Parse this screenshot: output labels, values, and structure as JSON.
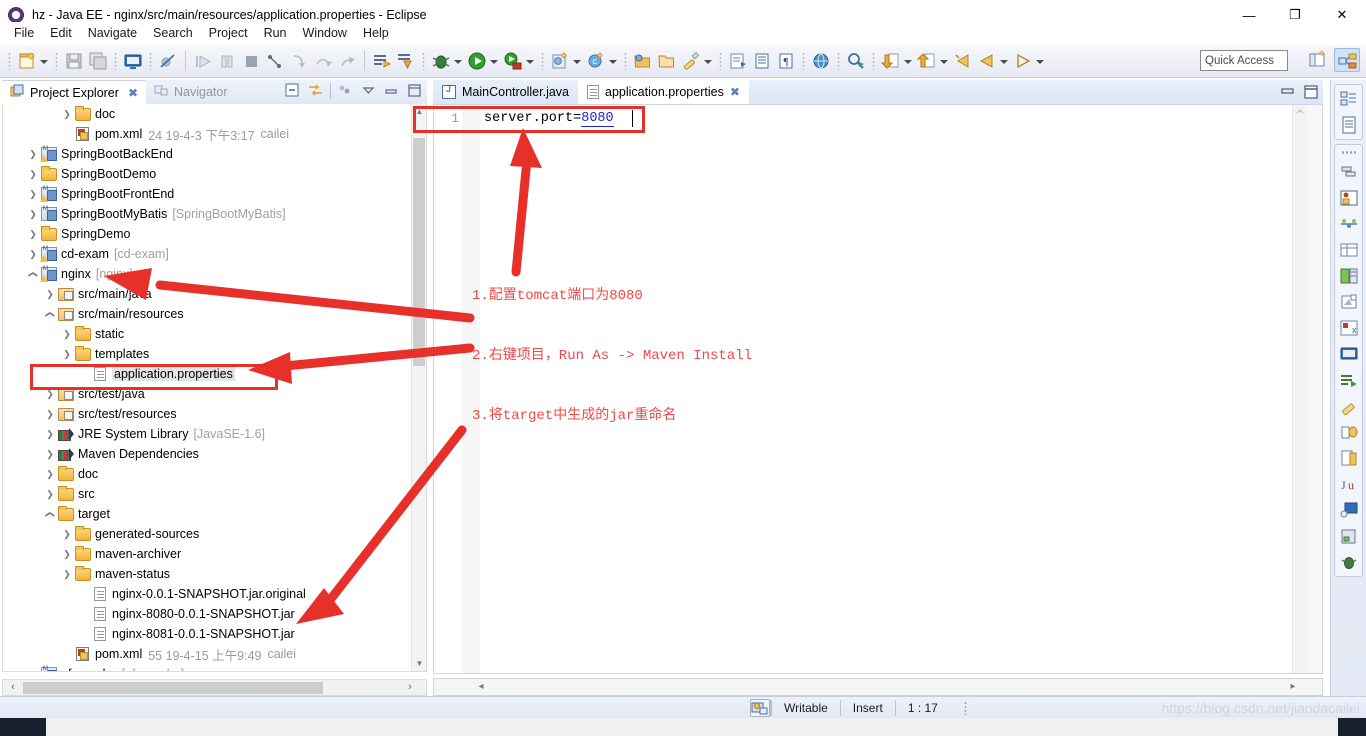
{
  "window": {
    "title": "hz - Java EE - nginx/src/main/resources/application.properties - Eclipse",
    "app_icon": "eclipse-icon",
    "minimize": "—",
    "maximize": "❐",
    "close": "✕"
  },
  "menu": {
    "items": [
      "File",
      "Edit",
      "Navigate",
      "Search",
      "Project",
      "Run",
      "Window",
      "Help"
    ]
  },
  "toolbar": {
    "quick_access_placeholder": "Quick Access",
    "icons": [
      "new-wizard-icon",
      "save-icon",
      "save-all-icon",
      "console-icon",
      "skip-breakpoints-icon",
      "resume-icon",
      "suspend-icon",
      "terminate-icon",
      "step-into-selection-icon",
      "step-into-icon",
      "step-over-icon",
      "step-return-icon",
      "run-last-tool-icon",
      "external-tools-icon",
      "debug-icon",
      "run-icon",
      "run-server-icon",
      "new-java-project-icon",
      "new-class-icon",
      "open-type-icon",
      "open-task-icon",
      "toggle-mark-occurrences-icon",
      "new-xml-icon",
      "show-whitespace-icon",
      "open-web-browser-icon",
      "search-icon",
      "next-annotation-icon",
      "previous-annotation-icon",
      "last-edit-location-icon",
      "back-icon",
      "forward-icon"
    ],
    "perspective_buttons": [
      "open-perspective-icon",
      "java-ee-perspective-icon"
    ]
  },
  "left_panel": {
    "tabs": [
      {
        "label": "Project Explorer",
        "icon": "project-explorer-icon",
        "active": true,
        "closable": true
      },
      {
        "label": "Navigator",
        "icon": "navigator-icon",
        "active": false,
        "closable": false
      }
    ],
    "toolbar_icons": [
      "collapse-all-icon",
      "link-with-editor-icon",
      "view-menu-icon",
      "minimize-icon",
      "maximize-icon"
    ],
    "tree": [
      {
        "indent": 3,
        "twist": "collapsed",
        "icon": "folder-icon",
        "label": "doc"
      },
      {
        "indent": 3,
        "twist": "none",
        "icon": "xml-file-icon",
        "label": "pom.xml",
        "meta": "24   19-4-3 下午3:17",
        "author": "cailei"
      },
      {
        "indent": 1,
        "twist": "collapsed",
        "icon": "maven-project-warn-icon",
        "label": "SpringBootBackEnd"
      },
      {
        "indent": 1,
        "twist": "collapsed",
        "icon": "folder-plain-icon",
        "label": "SpringBootDemo"
      },
      {
        "indent": 1,
        "twist": "collapsed",
        "icon": "maven-project-warn-icon",
        "label": "SpringBootFrontEnd"
      },
      {
        "indent": 1,
        "twist": "collapsed",
        "icon": "maven-project-icon",
        "label": "SpringBootMyBatis",
        "bracket": "[SpringBootMyBatis]"
      },
      {
        "indent": 1,
        "twist": "collapsed",
        "icon": "folder-plain-icon",
        "label": "SpringDemo"
      },
      {
        "indent": 1,
        "twist": "collapsed",
        "icon": "maven-project-warn-icon",
        "label": "cd-exam",
        "bracket": "[cd-exam]"
      },
      {
        "indent": 1,
        "twist": "expanded",
        "icon": "maven-project-warn-icon",
        "label": "nginx",
        "bracket": "[nginx]"
      },
      {
        "indent": 2,
        "twist": "collapsed",
        "icon": "source-folder-icon",
        "label": "src/main/java"
      },
      {
        "indent": 2,
        "twist": "expanded",
        "icon": "source-folder-icon",
        "label": "src/main/resources"
      },
      {
        "indent": 3,
        "twist": "collapsed",
        "icon": "folder-icon",
        "label": "static"
      },
      {
        "indent": 3,
        "twist": "collapsed",
        "icon": "folder-icon",
        "label": "templates"
      },
      {
        "indent": 4,
        "twist": "none",
        "icon": "properties-file-icon",
        "label": "application.properties",
        "selected": true
      },
      {
        "indent": 2,
        "twist": "collapsed",
        "icon": "source-folder-icon",
        "label": "src/test/java"
      },
      {
        "indent": 2,
        "twist": "collapsed",
        "icon": "source-folder-icon",
        "label": "src/test/resources"
      },
      {
        "indent": 2,
        "twist": "collapsed",
        "icon": "library-icon",
        "label": "JRE System Library",
        "bracket": "[JavaSE-1.6]"
      },
      {
        "indent": 2,
        "twist": "collapsed",
        "icon": "library-icon",
        "label": "Maven Dependencies"
      },
      {
        "indent": 2,
        "twist": "collapsed",
        "icon": "folder-icon",
        "label": "doc"
      },
      {
        "indent": 2,
        "twist": "collapsed",
        "icon": "folder-icon",
        "label": "src"
      },
      {
        "indent": 2,
        "twist": "expanded",
        "icon": "folder-open-icon",
        "label": "target"
      },
      {
        "indent": 3,
        "twist": "collapsed",
        "icon": "folder-open-icon",
        "label": "generated-sources"
      },
      {
        "indent": 3,
        "twist": "collapsed",
        "icon": "folder-open-icon",
        "label": "maven-archiver"
      },
      {
        "indent": 3,
        "twist": "collapsed",
        "icon": "folder-open-icon",
        "label": "maven-status"
      },
      {
        "indent": 4,
        "twist": "none",
        "icon": "file-icon",
        "label": "nginx-0.0.1-SNAPSHOT.jar.original"
      },
      {
        "indent": 4,
        "twist": "none",
        "icon": "file-icon",
        "label": "nginx-8080-0.0.1-SNAPSHOT.jar"
      },
      {
        "indent": 4,
        "twist": "none",
        "icon": "file-icon",
        "label": "nginx-8081-0.0.1-SNAPSHOT.jar"
      },
      {
        "indent": 3,
        "twist": "none",
        "icon": "xml-file-icon",
        "label": "pom.xml",
        "meta": "55   19-4-15 上午9:49",
        "author": "cailei"
      },
      {
        "indent": 1,
        "twist": "expanded",
        "icon": "maven-project-icon",
        "label": "qf-cms-be",
        "bracket": "[qf-cms-be]"
      }
    ],
    "hscroll": {
      "left_arrow": "‹",
      "right_arrow": "›"
    },
    "vscroll": {
      "up_arrow": "▲",
      "down_arrow": "▼"
    }
  },
  "editor": {
    "tabs": [
      {
        "label": "MainController.java",
        "icon": "java-file-icon",
        "active": false,
        "closable": false
      },
      {
        "label": "application.properties",
        "icon": "properties-file-icon",
        "active": true,
        "closable": true
      }
    ],
    "maximize_icons": [
      "restore-icon",
      "maximize-icon"
    ],
    "line_number": "1",
    "code_key": "server.port=",
    "code_value": "8080",
    "scroll_arrows": {
      "left": "◂",
      "right": "▸"
    }
  },
  "annotations": {
    "note1": "1.配置tomcat端口为8080",
    "note2": "2.右键项目，Run As -> Maven Install",
    "note3": "3.将target中生成的jar重命名",
    "color": "#f04a46"
  },
  "fastbar": {
    "icons": [
      "outline-view-icon",
      "properties-view-icon",
      "servers-view-icon",
      "data-source-explorer-icon",
      "snippets-view-icon",
      "problems-view-icon",
      "markers-view-icon",
      "console-view-icon",
      "progress-view-icon",
      "search-view-icon",
      "history-view-icon",
      "synchronize-view-icon",
      "junit-view-icon",
      "coverage-view-icon",
      "database-view-icon",
      "debug-view-icon"
    ]
  },
  "statusbar": {
    "writable": "Writable",
    "insert": "Insert",
    "position": "1 : 17",
    "lock_icon": "editor-status-icon"
  },
  "watermark": "https://blog.csdn.net/jiaodacailei",
  "colors": {
    "accent_red": "#e8302a",
    "code_value": "#2222cc",
    "chrome": "#e6e9f3"
  }
}
